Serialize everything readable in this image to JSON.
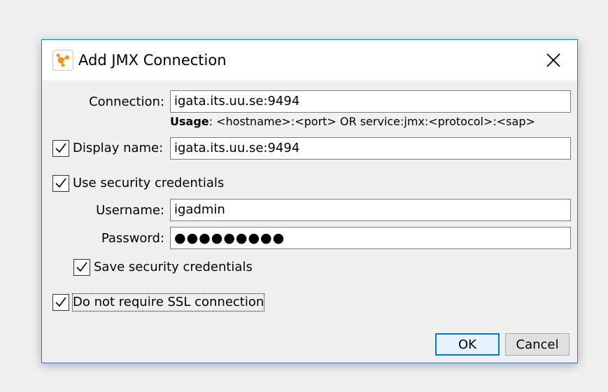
{
  "dialog": {
    "title": "Add JMX Connection",
    "icons": {
      "app": "visualvm-app-icon",
      "close": "close-icon",
      "check": "check-icon"
    }
  },
  "connection": {
    "label": "Connection:",
    "value": "igata.its.uu.se:9494",
    "usage_bold": "Usage",
    "usage_text": ": <hostname>:<port> OR service:jmx:<protocol>:<sap>"
  },
  "display_name": {
    "checkbox_label": "Display name:",
    "checked": true,
    "value": "igata.its.uu.se:9494"
  },
  "security": {
    "checkbox_label": "Use security credentials",
    "checked": true,
    "username_label": "Username:",
    "username_value": "igadmin",
    "password_label": "Password:",
    "password_value": "●●●●●●●●●",
    "save_label": "Save security credentials",
    "save_checked": true
  },
  "ssl": {
    "checkbox_label": "Do not require SSL connection",
    "checked": true
  },
  "buttons": {
    "ok": "OK",
    "cancel": "Cancel"
  },
  "colors": {
    "accent": "#0078d7",
    "window_border": "#1883d7",
    "icon_orange": "#f7931e"
  }
}
